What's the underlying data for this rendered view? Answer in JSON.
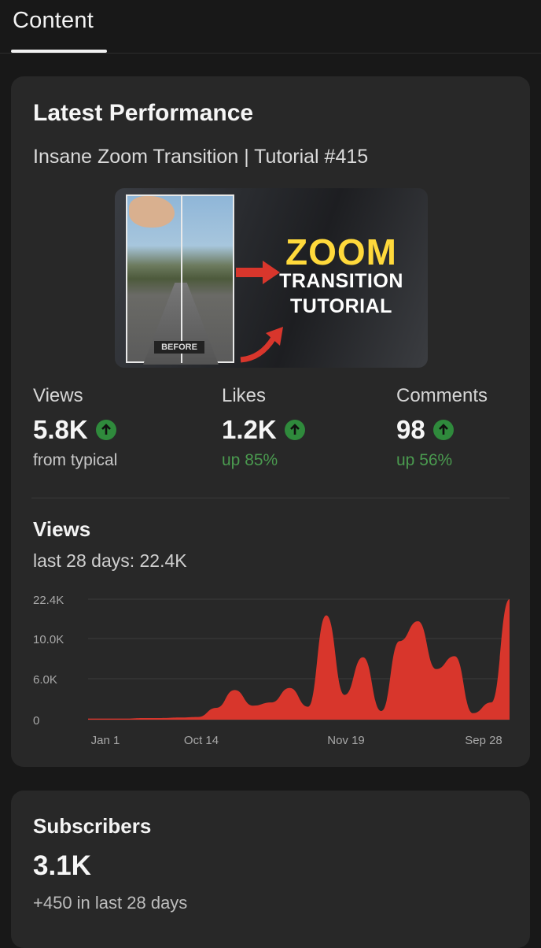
{
  "tabs": [
    {
      "label": "Content",
      "active": true
    }
  ],
  "performance": {
    "title": "Latest Performance",
    "video_title": "Insane Zoom Transition | Tutorial #415",
    "thumbnail": {
      "headline": "ZOOM",
      "line1": "TRANSITION",
      "line2": "TUTORIAL",
      "caption": "BEFORE"
    },
    "metrics": [
      {
        "label": "Views",
        "value": "5.8K",
        "sub": "from typical",
        "icon": "arrow-up-icon"
      },
      {
        "label": "Likes",
        "value": "1.2K",
        "sub": "up 85%",
        "icon": "arrow-up-icon"
      },
      {
        "label": "Comments",
        "value": "98",
        "sub": "up 56%",
        "icon": "arrow-up-icon"
      }
    ]
  },
  "views": {
    "title": "Views",
    "subtitle": "last 28 days: 22.4K"
  },
  "chart_data": {
    "type": "area",
    "y_tick_labels": [
      "22.4K",
      "10.0K",
      "6.0K",
      "0"
    ],
    "x_tick_labels": [
      "Jan 1",
      "Oct 14",
      "Nov 19",
      "Sep 28"
    ],
    "ylim": [
      0,
      22.4
    ],
    "grid": true,
    "color": "#d8362c",
    "y": [
      0.2,
      0.2,
      0.2,
      0.3,
      0.3,
      0.4,
      0.5,
      2.2,
      5.5,
      2.6,
      3.2,
      5.9,
      2.4,
      19.4,
      4.6,
      11.6,
      1.6,
      14.6,
      18.3,
      9.4,
      11.8,
      1.2,
      3.2,
      22.4
    ]
  },
  "subscribers": {
    "title": "Subscribers",
    "value": "3.1K",
    "sub": "+450 in last 28 days"
  },
  "colors": {
    "background": "#181818",
    "card": "#282828",
    "accent_red": "#d8362c",
    "positive_green": "#4a9a4f",
    "thumb_yellow": "#ffd93b"
  }
}
